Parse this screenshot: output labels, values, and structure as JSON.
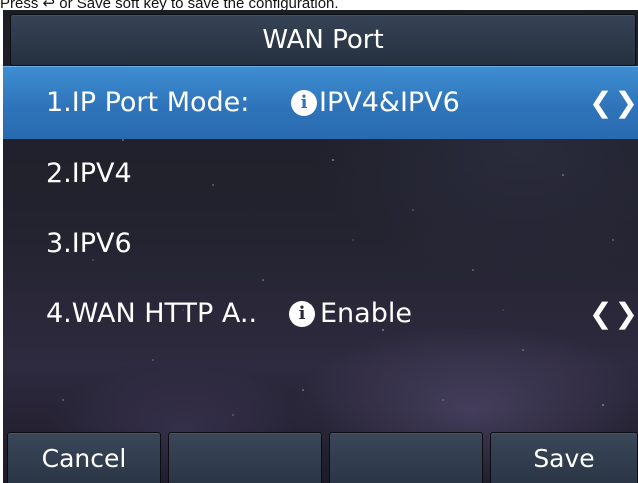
{
  "instruction": "Press ↩ or Save soft key to save the configuration.",
  "title": "WAN Port",
  "rows": [
    {
      "label": "1.IP Port Mode:",
      "value": "IPV4&IPV6",
      "arrows": "❮❯",
      "selected": true
    },
    {
      "label": "2.IPV4"
    },
    {
      "label": "3.IPV6"
    },
    {
      "label": "4.WAN HTTP A..",
      "value": "Enable",
      "arrows": "❮❯"
    }
  ],
  "info_icon_glyph": "i",
  "softkeys": [
    "Cancel",
    "",
    "",
    "Save"
  ],
  "colors": {
    "selected_row": "#2f74ba",
    "titlebar": "#2e3a4a",
    "softkey": "#323f50"
  }
}
